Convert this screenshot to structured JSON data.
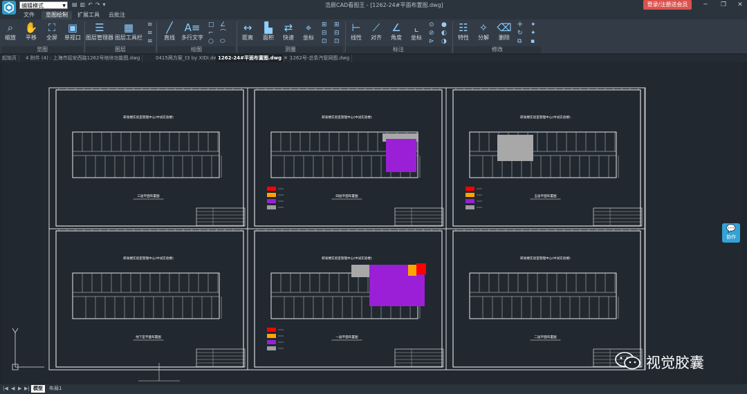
{
  "titlebar": {
    "mode": "编辑模式",
    "window_title": "浩辰CAD看图王 - [1262-24#平面布置图.dwg]",
    "login_label": "登录/注册送会员"
  },
  "menu": {
    "tabs": [
      "文件",
      "览图绘制",
      "扩展工具",
      "云批注"
    ],
    "active": 1
  },
  "ribbon": {
    "zoom": "缩放",
    "pan": "平移",
    "fullscreen": "全屏",
    "single_view": "单视口",
    "layer_manager": "图层管理器",
    "layer_toolbar": "图层工具栏",
    "line": "直线",
    "mtext": "多行文字",
    "distance": "距离",
    "area": "面积",
    "quick": "快速",
    "coordinate": "坐标",
    "linear": "线性",
    "aligned": "对齐",
    "angle": "角度",
    "ordinate": "坐标",
    "properties": "特性",
    "explode": "分解",
    "delete": "删除",
    "groups": {
      "view": "览图",
      "layer": "图层",
      "draw": "绘图",
      "measure": "测量",
      "dim": "标注",
      "modify": "修改"
    }
  },
  "doc_tabs": [
    "起始页",
    "4 附件 (4) : 上海市延安西路1262号地块功能图.dwg",
    "0415两方案_t3 by XIDI.dwg",
    "1262-24#平面布置图.dwg",
    "1262号-总条汽管网图.dwg"
  ],
  "active_doc_tab": 3,
  "drawing": {
    "sheets": [
      {
        "header": "研发楼实验室管理中心(中试实验楼)",
        "caption": "三层平面布置图"
      },
      {
        "header": "研发楼实验室管理中心(中试实验楼)",
        "caption": "四层平面布置图"
      },
      {
        "header": "研发楼实验室管理中心(中试实验楼)",
        "caption": "五层平面布置图"
      },
      {
        "header": "研发楼实验室管理中心(中试实验楼)",
        "caption": "地下室平面布置图"
      },
      {
        "header": "研发楼实验室管理中心(中试实验楼)",
        "caption": "一层平面布置图"
      },
      {
        "header": "研发楼实验室管理中心(中试实验楼)",
        "caption": "二层平面布置图"
      }
    ],
    "legend_colors": [
      "#ff0000",
      "#ffa500",
      "#9a1fd6",
      "#9e9e9e"
    ],
    "highlight_purple": "#9a1fd6",
    "highlight_gray": "#a8a8a8"
  },
  "collab_label": "协作",
  "watermark_text": "视觉胶囊",
  "layout_tabs": [
    "模型",
    "布局1"
  ],
  "active_layout_tab": 0
}
